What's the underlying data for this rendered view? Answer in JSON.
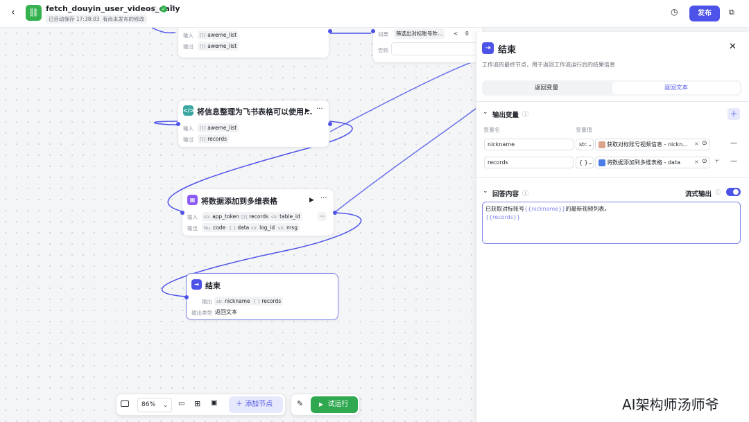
{
  "header": {
    "title": "fetch_douyin_user_videos_daily",
    "autosave": "已自动保存 17:38:03",
    "unpublished": "有尚未发布的修改",
    "publish_label": "发布"
  },
  "nodes": {
    "top": {
      "input_label": "输入",
      "input_var": "aweme_list",
      "output_label": "输出",
      "output_var": "aweme_list",
      "type_glyph": "[]{"
    },
    "cond": {
      "if_label": "如果",
      "condition": "筛选出对标账号昨...",
      "op": "<",
      "value": "0",
      "else_label": "否则"
    },
    "code": {
      "title": "将信息整理为飞书表格可以使用...",
      "input_label": "输入",
      "input_var": "aweme_list",
      "output_label": "输出",
      "output_var": "records",
      "type_glyph": "[]{"
    },
    "plugin": {
      "title": "将数据添加到多维表格",
      "input_label": "输入",
      "inputs": [
        {
          "t": "str.",
          "v": "app_token"
        },
        {
          "t": "[]{",
          "v": "records"
        },
        {
          "t": "str.",
          "v": "table_id"
        }
      ],
      "output_label": "输出",
      "outputs": [
        {
          "t": "Nu.",
          "v": "code"
        },
        {
          "t": "{ }",
          "v": "data"
        },
        {
          "t": "str.",
          "v": "log_id"
        },
        {
          "t": "str.",
          "v": "msg"
        }
      ],
      "more": "···"
    },
    "end": {
      "title": "结束",
      "output_label": "输出",
      "outputs": [
        {
          "t": "str.",
          "v": "nickname"
        },
        {
          "t": "{ }",
          "v": "records"
        }
      ],
      "type_label": "输出类型",
      "type_value": "返回文本"
    }
  },
  "panel": {
    "title": "结束",
    "description": "工作流的最终节点，用于返回工作流运行后的结果信息",
    "tabs": [
      "返回变量",
      "返回文本"
    ],
    "active_tab": 1,
    "output_section": "输出变量",
    "col_name": "变量名",
    "col_value": "变量值",
    "rows": [
      {
        "name": "nickname",
        "type": "str.",
        "ref": "获取对标账号视频信息 - nickn..."
      },
      {
        "name": "records",
        "type": "{ }",
        "ref": "将数据添加到多维表格 - data"
      }
    ],
    "answer_section": "回答内容",
    "stream_label": "流式输出",
    "stream_on": true,
    "answer_prefix": "已获取对标账号",
    "answer_var1": "{{nickname}}",
    "answer_suffix": "的最新视频列表。",
    "answer_var2": "{{records}}"
  },
  "toolbar": {
    "zoom": "86%",
    "add_node": "添加节点",
    "run": "试运行"
  },
  "watermark": "AI架构师汤师爷",
  "colors": {
    "accent": "#4d53e8",
    "run_green": "#2fa84f"
  }
}
